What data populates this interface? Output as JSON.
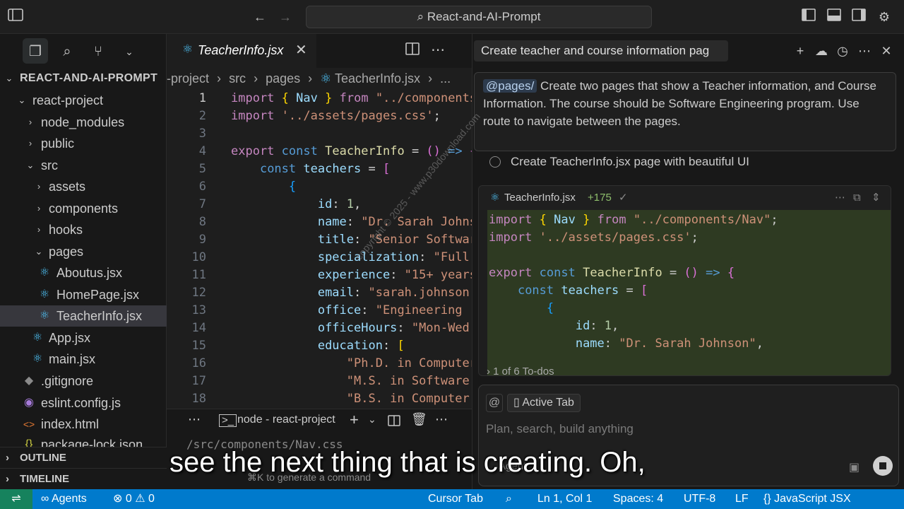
{
  "titlebar": {
    "search_text": "React-and-AI-Prompt"
  },
  "explorer": {
    "root": "REACT-AND-AI-PROMPT",
    "items": [
      {
        "label": "react-project",
        "kind": "folder-open"
      },
      {
        "label": "node_modules",
        "kind": "folder"
      },
      {
        "label": "public",
        "kind": "folder"
      },
      {
        "label": "src",
        "kind": "folder-open"
      },
      {
        "label": "assets",
        "kind": "folder"
      },
      {
        "label": "components",
        "kind": "folder"
      },
      {
        "label": "hooks",
        "kind": "folder"
      },
      {
        "label": "pages",
        "kind": "folder-open"
      },
      {
        "label": "Aboutus.jsx",
        "kind": "react-file"
      },
      {
        "label": "HomePage.jsx",
        "kind": "react-file"
      },
      {
        "label": "TeacherInfo.jsx",
        "kind": "react-file"
      },
      {
        "label": "App.jsx",
        "kind": "react-file"
      },
      {
        "label": "main.jsx",
        "kind": "react-file"
      },
      {
        "label": ".gitignore",
        "kind": "git-file"
      },
      {
        "label": "eslint.config.js",
        "kind": "eslint-file"
      },
      {
        "label": "index.html",
        "kind": "html-file"
      },
      {
        "label": "package-lock.json",
        "kind": "json-file"
      }
    ],
    "outline": "OUTLINE",
    "timeline": "TIMELINE"
  },
  "editor": {
    "tab_label": "TeacherInfo.jsx",
    "breadcrumb": [
      "-project",
      "src",
      "pages",
      "TeacherInfo.jsx",
      "..."
    ],
    "line_numbers": [
      "1",
      "2",
      "3",
      "4",
      "5",
      "6",
      "7",
      "8",
      "9",
      "10",
      "11",
      "12",
      "13",
      "14",
      "15",
      "16",
      "17",
      "18"
    ]
  },
  "terminal": {
    "title": "node - react-project",
    "output": "/src/components/Nav.css",
    "hint": "⌘K to generate a command"
  },
  "chat": {
    "title": "Create teacher and course information pag",
    "prompt_mention": "@pages/",
    "prompt_text": "Create two pages that show a Teacher information, and Course Information. The course should be Software Engineering program.  Use route to navigate between the pages.",
    "todo_item": "Create TeacherInfo.jsx page with beautiful UI",
    "diff_file": "TeacherInfo.jsx",
    "diff_count": "+175",
    "todos_summary": "1 of 6 To-dos",
    "active_tab_chip": "Active Tab",
    "input_placeholder": "Plan, search, build anything",
    "agent_chip": "Agent"
  },
  "subtitle": "see the next thing that is creating. Oh,",
  "watermark": "copyright © 2025 - www.p30download.com",
  "statusbar": {
    "agents": "Agents",
    "errors": "0",
    "warnings": "0",
    "cursor_tab": "Cursor Tab",
    "position": "Ln 1, Col 1",
    "spaces": "Spaces: 4",
    "encoding": "UTF-8",
    "eol": "LF",
    "language": "JavaScript JSX"
  },
  "colors": {
    "accent": "#007acc",
    "remote": "#16825d",
    "diff_bg": "#2e3a22",
    "react_icon": "#4fc3f7"
  }
}
